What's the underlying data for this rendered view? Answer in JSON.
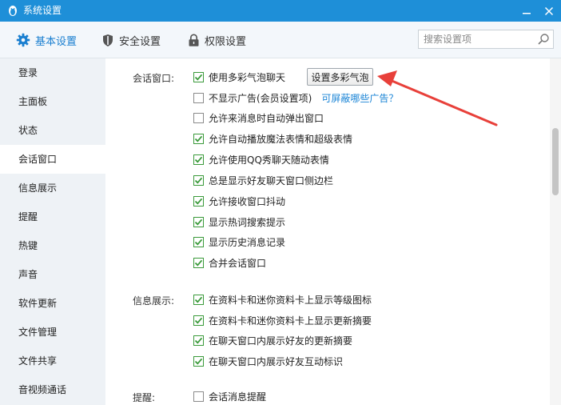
{
  "window": {
    "title": "系统设置",
    "accent_color": "#1e8fd8"
  },
  "toolbar": {
    "tabs": [
      {
        "label": "基本设置",
        "icon": "gear-icon",
        "active": true
      },
      {
        "label": "安全设置",
        "icon": "shield-icon",
        "active": false
      },
      {
        "label": "权限设置",
        "icon": "lock-icon",
        "active": false
      }
    ],
    "search": {
      "placeholder": "搜索设置项",
      "value": ""
    }
  },
  "sidebar": {
    "items": [
      {
        "label": "登录"
      },
      {
        "label": "主面板"
      },
      {
        "label": "状态"
      },
      {
        "label": "会话窗口",
        "active": true
      },
      {
        "label": "信息展示"
      },
      {
        "label": "提醒"
      },
      {
        "label": "热键"
      },
      {
        "label": "声音"
      },
      {
        "label": "软件更新"
      },
      {
        "label": "文件管理"
      },
      {
        "label": "文件共享"
      },
      {
        "label": "音视频通话"
      }
    ]
  },
  "sections": {
    "session": {
      "label": "会话窗口:",
      "bubble_button": "设置多彩气泡",
      "link": "可屏蔽哪些广告？",
      "options": [
        {
          "label": "使用多彩气泡聊天",
          "checked": true
        },
        {
          "label": "不显示广告(会员设置项)",
          "checked": false
        },
        {
          "label": "允许来消息时自动弹出窗口",
          "checked": false
        },
        {
          "label": "允许自动播放魔法表情和超级表情",
          "checked": true
        },
        {
          "label": "允许使用QQ秀聊天随动表情",
          "checked": true
        },
        {
          "label": "总是显示好友聊天窗口侧边栏",
          "checked": true
        },
        {
          "label": "允许接收窗口抖动",
          "checked": true
        },
        {
          "label": "显示热词搜索提示",
          "checked": true
        },
        {
          "label": "显示历史消息记录",
          "checked": true
        },
        {
          "label": "合并会话窗口",
          "checked": true
        }
      ]
    },
    "info": {
      "label": "信息展示:",
      "options": [
        {
          "label": "在资料卡和迷你资料卡上显示等级图标",
          "checked": true
        },
        {
          "label": "在资料卡和迷你资料卡上显示更新摘要",
          "checked": true
        },
        {
          "label": "在聊天窗口内展示好友的更新摘要",
          "checked": true
        },
        {
          "label": "在聊天窗口内展示好友互动标识",
          "checked": true
        }
      ]
    },
    "remind": {
      "label": "提醒:",
      "options": [
        {
          "label": "会话消息提醒",
          "checked": false
        }
      ]
    }
  },
  "colors": {
    "check_green": "#3a9a3a",
    "link_blue": "#1a84d6",
    "annotation_red": "#e8403a"
  }
}
